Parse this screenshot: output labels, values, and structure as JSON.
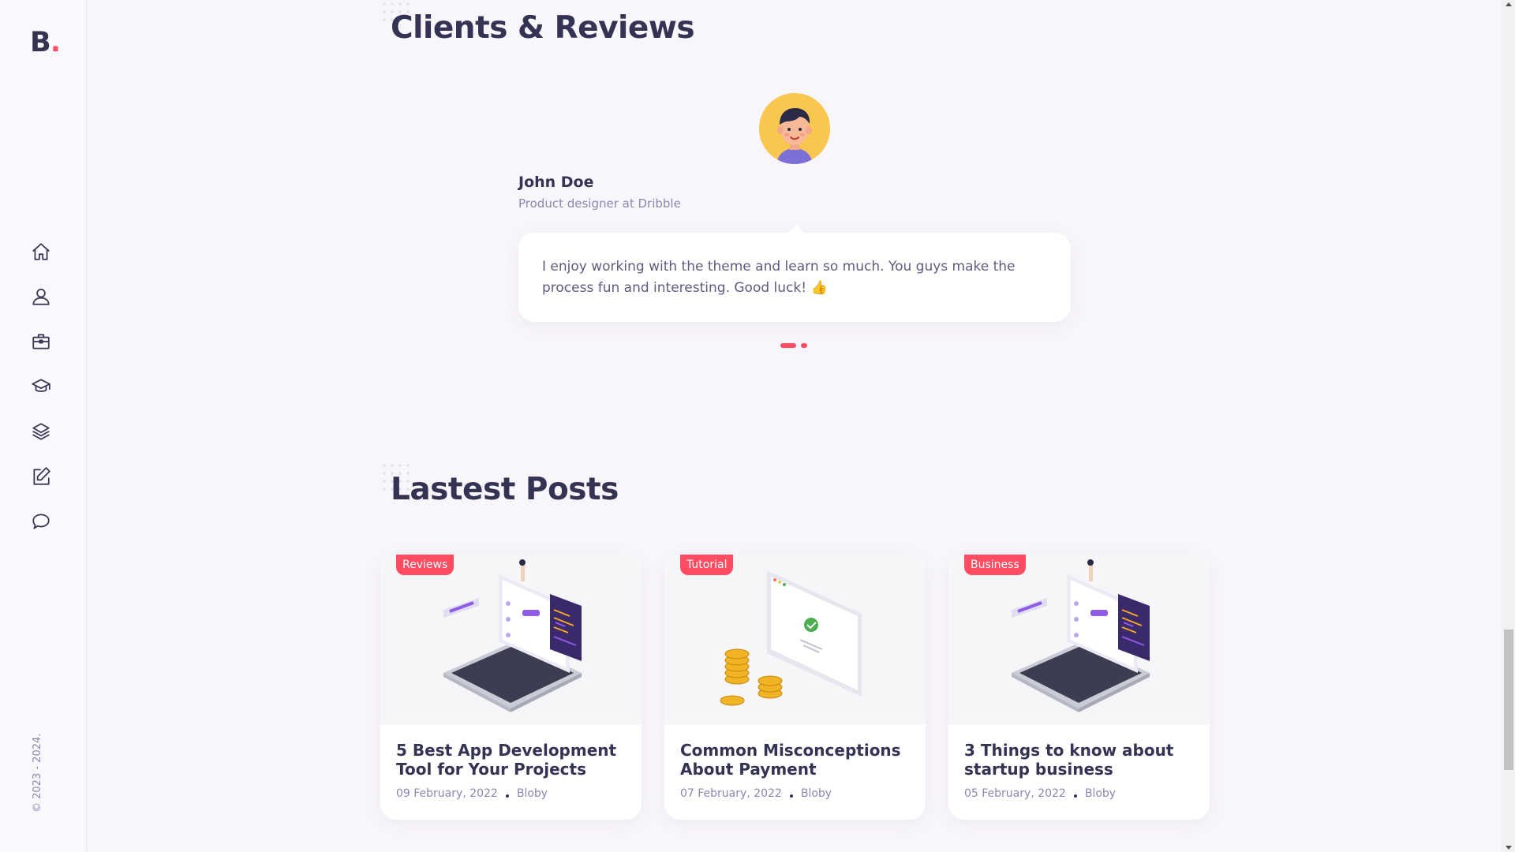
{
  "brand": {
    "logo_letter": "B",
    "logo_dot": ".",
    "accent_color": "#ff4c60"
  },
  "sidebar": {
    "nav": [
      {
        "icon": "home-icon"
      },
      {
        "icon": "user-icon"
      },
      {
        "icon": "briefcase-icon"
      },
      {
        "icon": "graduation-cap-icon"
      },
      {
        "icon": "layers-icon"
      },
      {
        "icon": "edit-icon"
      },
      {
        "icon": "chat-bubble-icon"
      }
    ],
    "copyright": "© 2023 - 2024."
  },
  "reviews": {
    "title": "Clients & Reviews",
    "name": "John Doe",
    "role": "Product designer at Dribble",
    "text": "I enjoy working with the theme and learn so much. You guys make the process fun and interesting. Good luck! 👍",
    "pages": 2,
    "active_page": 1
  },
  "posts": {
    "title": "Lastest Posts",
    "items": [
      {
        "category": "Reviews",
        "title": "5 Best App Development Tool for Your Projects",
        "date": "09 February, 2022",
        "author": "Bloby",
        "image": "laptop-illustration"
      },
      {
        "category": "Tutorial",
        "title": "Common Misconceptions About Payment",
        "date": "07 February, 2022",
        "author": "Bloby",
        "image": "payment-illustration"
      },
      {
        "category": "Business",
        "title": "3 Things to know about startup business",
        "date": "05 February, 2022",
        "author": "Bloby",
        "image": "laptop-illustration"
      }
    ]
  }
}
